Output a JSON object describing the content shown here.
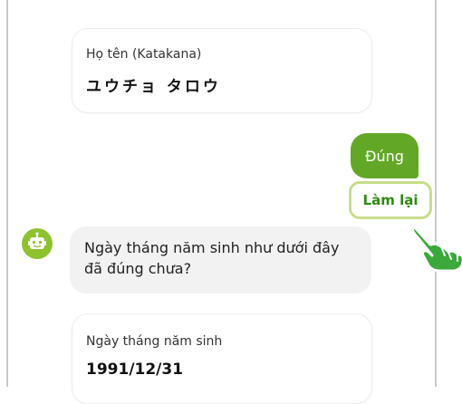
{
  "name_card": {
    "label": "Họ tên (Katakana)",
    "value": "ユウチョ タロウ"
  },
  "user_reply": {
    "text": "Đúng"
  },
  "retry_button": {
    "label": "Làm lại"
  },
  "bot_message": {
    "line1": "Ngày tháng năm sinh như dưới đây",
    "line2": "đã đúng chưa?"
  },
  "birth_card": {
    "label": "Ngày tháng năm sinh",
    "value": "1991/12/31"
  },
  "colors": {
    "accent_green": "#62a826",
    "avatar_green": "#8dc22f",
    "retry_border": "#c7de8a",
    "hand_green": "#3aa83a",
    "bot_bubble_bg": "#f2f2f2"
  },
  "icons": {
    "bot_avatar": "robot-icon",
    "pointer": "pointing-hand-icon"
  }
}
